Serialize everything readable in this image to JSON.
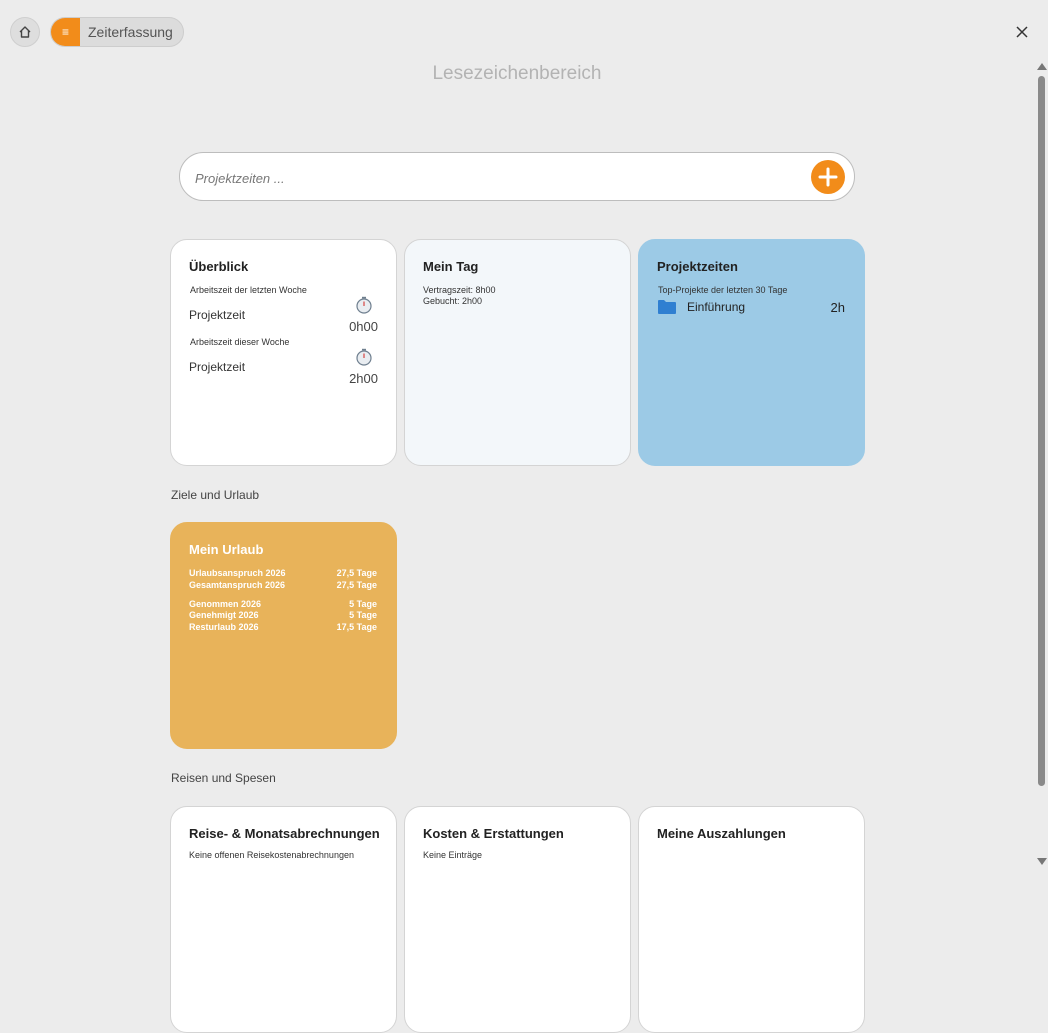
{
  "topbar": {
    "module_label": "Zeiterfassung",
    "menu_icon": "hamburger-icon",
    "home_icon": "home-icon",
    "close_icon": "close-icon"
  },
  "bookmarks": {
    "title": "Lesezeichenbereich"
  },
  "search": {
    "placeholder": "Projektzeiten ...",
    "add_icon": "plus-icon"
  },
  "cards": {
    "overview": {
      "title": "Überblick",
      "last_week_label": "Arbeitszeit der letzten Woche",
      "last_week_item": "Projektzeit",
      "last_week_value": "0h00",
      "this_week_label": "Arbeitszeit dieser Woche",
      "this_week_item": "Projektzeit",
      "this_week_value": "2h00",
      "timer_icon": "stopwatch-icon"
    },
    "myday": {
      "title": "Mein Tag",
      "contract": "Vertragszeit: 8h00",
      "booked": "Gebucht: 2h00"
    },
    "project": {
      "title": "Projektzeiten",
      "subtitle": "Top-Projekte der letzten 30 Tage",
      "items": [
        {
          "name": "Einführung",
          "hours": "2h"
        }
      ],
      "folder_icon": "folder-icon"
    }
  },
  "sections": {
    "goals": "Ziele und Urlaub",
    "travel": "Reisen und Spesen"
  },
  "vacation": {
    "title": "Mein Urlaub",
    "rows": [
      {
        "label": "Urlaubsanspruch 2026",
        "value": "27,5 Tage"
      },
      {
        "label": "Gesamtanspruch 2026",
        "value": "27,5 Tage"
      },
      {
        "label": "Genommen 2026",
        "value": "5 Tage"
      },
      {
        "label": "Genehmigt 2026",
        "value": "5 Tage"
      },
      {
        "label": "Resturlaub 2026",
        "value": "17,5 Tage"
      }
    ]
  },
  "travel_cards": {
    "travel": {
      "title": "Reise- & Monatsabrechnungen",
      "subtitle": "Keine offenen Reisekostenabrechnungen"
    },
    "costs": {
      "title": "Kosten & Erstattungen",
      "subtitle": "Keine Einträge"
    },
    "payouts": {
      "title": "Meine Auszahlungen"
    }
  },
  "colors": {
    "accent": "#f28c1a",
    "project_card": "#9ccae6",
    "vacation_card": "#e8b35a",
    "myday_card": "#f3f7fa",
    "folder": "#2f7fd1"
  }
}
